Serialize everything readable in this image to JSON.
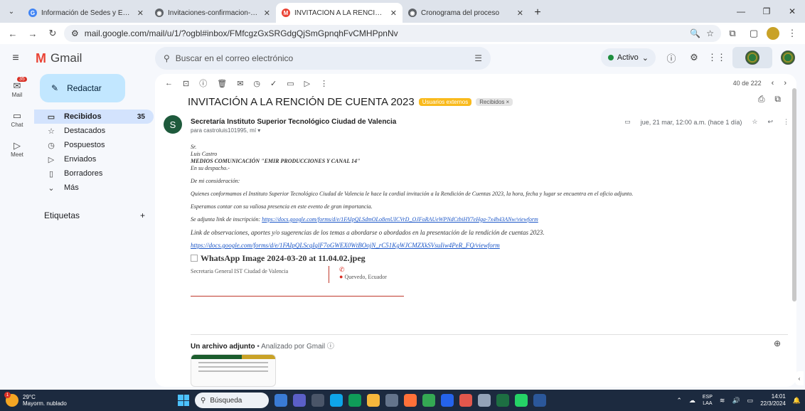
{
  "browser": {
    "tabs": [
      {
        "title": "Información de Sedes y Extensi",
        "fav_color": "#4285f4",
        "active": false
      },
      {
        "title": "Invitaciones-confirmacion-y-asi",
        "fav_color": "#5f6368",
        "active": false
      },
      {
        "title": "INVITACIÓN A LA RENCIÓN DE",
        "fav_color": "#ea4335",
        "active": true
      },
      {
        "title": "Cronograma del proceso",
        "fav_color": "#5f6368",
        "active": false
      }
    ],
    "url": "mail.google.com/mail/u/1/?ogbl#inbox/FMfcgzGxSRGdgQjSmGpnqhFvCMHPpnNv"
  },
  "gmail": {
    "app_name": "Gmail",
    "search_placeholder": "Buscar en el correo electrónico",
    "status": "Activo",
    "rail": [
      {
        "label": "Mail",
        "badge": "35",
        "icon": "mail-icon"
      },
      {
        "label": "Chat",
        "icon": "chat-icon"
      },
      {
        "label": "Meet",
        "icon": "meet-icon"
      }
    ],
    "compose_label": "Redactar",
    "nav": [
      {
        "label": "Recibidos",
        "count": "35",
        "icon": "inbox-icon",
        "active": true
      },
      {
        "label": "Destacados",
        "count": "",
        "icon": "star-icon",
        "active": false
      },
      {
        "label": "Pospuestos",
        "count": "",
        "icon": "clock-icon",
        "active": false
      },
      {
        "label": "Enviados",
        "count": "",
        "icon": "send-icon",
        "active": false
      },
      {
        "label": "Borradores",
        "count": "",
        "icon": "draft-icon",
        "active": false
      },
      {
        "label": "Más",
        "count": "",
        "icon": "chevron-down-icon",
        "active": false
      }
    ],
    "labels_title": "Etiquetas"
  },
  "email": {
    "pager": "40 de 222",
    "subject": "INVITACIÓN A LA RENCIÓN DE CUENTA 2023",
    "tag_external": "Usuarios externos",
    "tag_inbox": "Recibidos ×",
    "sender_initial": "S",
    "sender": "Secretaría Instituto Superior Tecnológico Ciudad de Valencia",
    "to": "para castroluis101995, mí ▾",
    "date": "jue, 21 mar, 12:00 a.m. (hace 1 día)",
    "body": {
      "salutation": "Sr.",
      "name": "Luis Castro",
      "org": "MEDIOS COMUNICACIÓN \"EMIR PRODUCCIONES Y CANAL 14\"",
      "office": "En su despacho.-",
      "greeting": "De mi consideración:",
      "para1": "Quienes conformamos el Instituto Superior Tecnológico Ciudad de Valencia le hace la cordial invitación a la Rendición de Cuentas 2023, la hora, fecha y lugar se encuentra en el oficio adjunto.",
      "para2": "Esperamos contar con su valiosa presencia en este evento de gran importancia.",
      "link_intro": "Se adjunta link de inscripción:",
      "link1": "https://docs.google.com/forms/d/e/1FAIpQLSdmOLo8enUICVrD_OJFoRAUeWPNdCtbiHY7eHga-7x4h43ANw/viewform",
      "para3": "Link de observaciones, aportes y/o sugerencias de los temas a abordarse o abordados en la presentación de la rendición de cuentas 2023.",
      "link2": "https://docs.google.com/forms/d/e/1FAIpQLScqIqlF7oGWEX0WtBOojN_rC51KgWJCMZXkSVsuIiw4PeR_FQ/viewform",
      "image_alt": "WhatsApp Image 2024-03-20 at 11.04.02.jpeg",
      "sig_left": "Secretaria General IST Ciudad de Valencia",
      "sig_location": "Quevedo, Ecuador"
    },
    "attachment_label": "Un archivo adjunto",
    "attachment_scan": " • Analizado por Gmail ⓘ"
  },
  "taskbar": {
    "temp": "29°C",
    "weather": "Mayorm. nublado",
    "weather_badge": "1",
    "search": "Búsqueda",
    "lang1": "ESP",
    "lang2": "LAA",
    "time": "14:01",
    "date": "22/3/2024"
  }
}
